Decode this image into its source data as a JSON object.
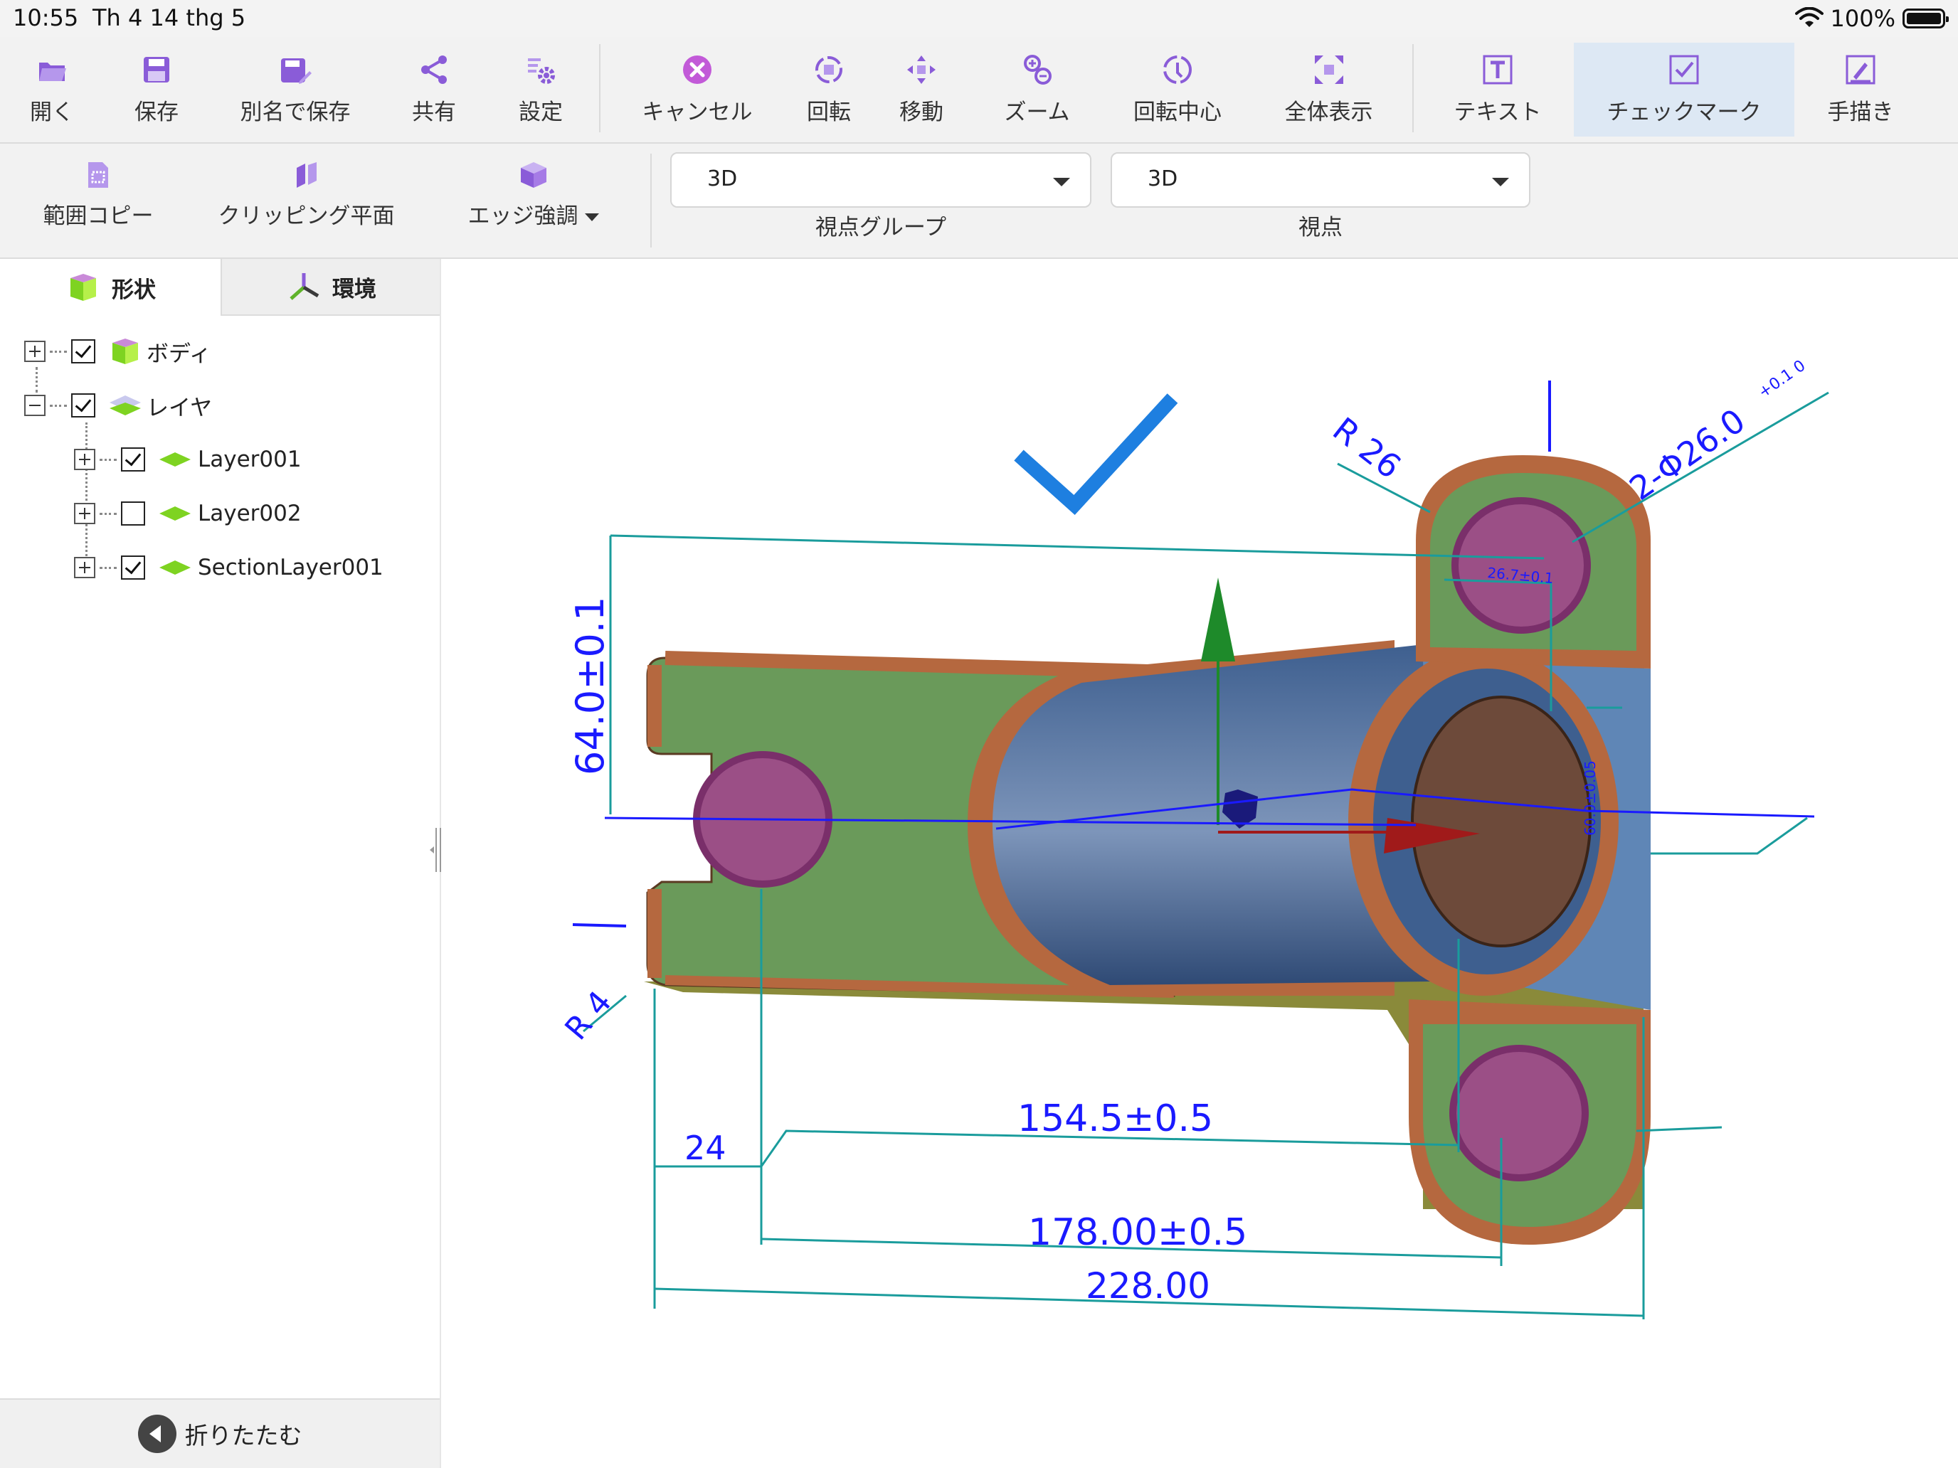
{
  "status_bar": {
    "time": "10:55",
    "date": "Th 4 14 thg 5",
    "battery": "100%"
  },
  "toolbar": {
    "open": "開く",
    "save": "保存",
    "save_as": "別名で保存",
    "share": "共有",
    "settings": "設定",
    "cancel": "キャンセル",
    "rotate": "回転",
    "move": "移動",
    "zoom": "ズーム",
    "rotation_center": "回転中心",
    "fit_all": "全体表示",
    "text": "テキスト",
    "checkmark": "チェックマーク",
    "freehand": "手描き"
  },
  "toolbar2": {
    "range_copy": "範囲コピー",
    "clipping_plane": "クリッピング平面",
    "edge_emphasis": "エッジ強調",
    "view_group_value": "3D",
    "view_group_label": "視点グループ",
    "viewpoint_value": "3D",
    "viewpoint_label": "視点"
  },
  "panel": {
    "tab_shape": "形状",
    "tab_environment": "環境",
    "tree": {
      "body": "ボディ",
      "layer": "レイヤ",
      "layer001": "Layer001",
      "layer002": "Layer002",
      "section_layer001": "SectionLayer001"
    },
    "collapse": "折りたたむ"
  },
  "model": {
    "dim_height": "64.0±0.1",
    "dim_r26": "R 26",
    "dim_hole": "2-Φ26.0",
    "dim_hole_tol": "+0.1 0",
    "dim_r4": "R 4",
    "dim_24": "24",
    "dim_154": "154.5±0.5",
    "dim_178": "178.00±0.5",
    "dim_228": "228.00",
    "dim_small_1": "26.7±0.1",
    "dim_small_2": "60.0±0.05"
  },
  "colors": {
    "accent": "#1e7fe0",
    "active_tab_bg": "#dde8f4",
    "icon_purple": "#8a5cd8",
    "body_green": "#6a9a5a",
    "fillet_copper": "#b5683f",
    "hole_purple": "#9b4f86",
    "pipe_blue": "#4d6896",
    "dim_blue": "#1a1aff",
    "dim_teal": "#1a9c9c"
  }
}
